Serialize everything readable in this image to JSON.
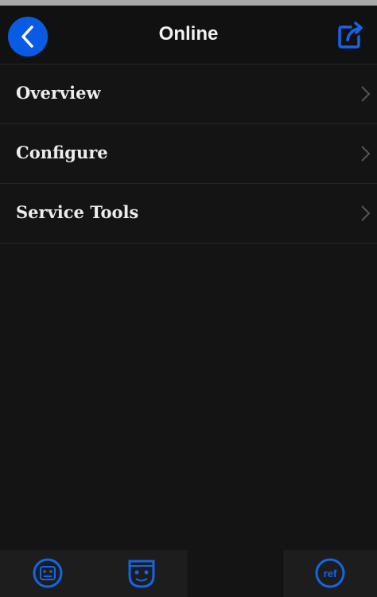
{
  "header": {
    "title": "Online",
    "back_icon": "chevron-left-icon",
    "export_icon": "share-export-icon"
  },
  "menu": {
    "items": [
      {
        "label": "Overview",
        "icon": "chevron-right-icon"
      },
      {
        "label": "Configure",
        "icon": "chevron-right-icon"
      },
      {
        "label": "Service Tools",
        "icon": "chevron-right-icon"
      }
    ]
  },
  "bottom_bar": {
    "items": [
      {
        "icon": "controller-icon"
      },
      {
        "icon": "unit-face-icon"
      },
      {
        "icon": "ref-icon",
        "text": "ref"
      }
    ]
  },
  "colors": {
    "accent": "#0a5be3",
    "icon_blue": "#1565e8",
    "background": "#141414",
    "text": "#ededed"
  }
}
